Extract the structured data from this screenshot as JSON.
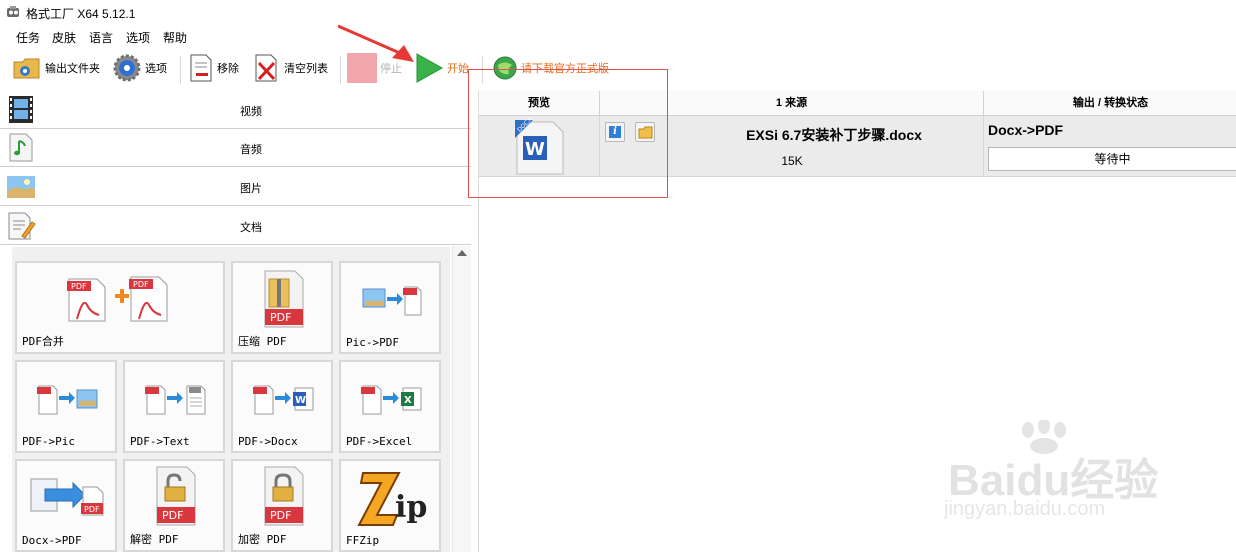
{
  "window": {
    "title": "格式工厂 X64 5.12.1"
  },
  "menu": {
    "items": [
      "任务",
      "皮肤",
      "语言",
      "选项",
      "帮助"
    ]
  },
  "toolbar": {
    "output_folder": "输出文件夹",
    "options": "选项",
    "remove": "移除",
    "clear_list": "清空列表",
    "stop": "停止",
    "start": "开始",
    "download": "请下载官方正式版"
  },
  "categories": [
    "视频",
    "音频",
    "图片",
    "文档"
  ],
  "tools": [
    {
      "label": "PDF合并",
      "icon": "pdf-merge-icon"
    },
    {
      "label": "压缩 PDF",
      "icon": "pdf-compress-icon"
    },
    {
      "label": "Pic->PDF",
      "icon": "pic-to-pdf-icon"
    },
    {
      "label": "PDF->Pic",
      "icon": "pdf-to-pic-icon"
    },
    {
      "label": "PDF->Text",
      "icon": "pdf-to-text-icon"
    },
    {
      "label": "PDF->Docx",
      "icon": "pdf-to-docx-icon"
    },
    {
      "label": "PDF->Excel",
      "icon": "pdf-to-excel-icon"
    },
    {
      "label": "Docx->PDF",
      "icon": "docx-to-pdf-icon"
    },
    {
      "label": "解密 PDF",
      "icon": "pdf-decrypt-icon"
    },
    {
      "label": "加密 PDF",
      "icon": "pdf-encrypt-icon"
    },
    {
      "label": "FFZip",
      "icon": "ffzip-icon"
    }
  ],
  "table": {
    "columns": [
      "预览",
      "1 来源",
      "输出 / 转换状态"
    ],
    "rows": [
      {
        "filename": "EXSi 6.7安装补丁步骤.docx",
        "size": "15K",
        "output_format": "Docx->PDF",
        "status": "等待中"
      }
    ]
  },
  "watermark": {
    "brand": "Baidu经验",
    "url": "jingyan.baidu.com"
  },
  "colors": {
    "pdf_red": "#d9363e",
    "start_green": "#37b34a",
    "annotation_red": "#e53935",
    "download_orange": "#e66a1a"
  }
}
